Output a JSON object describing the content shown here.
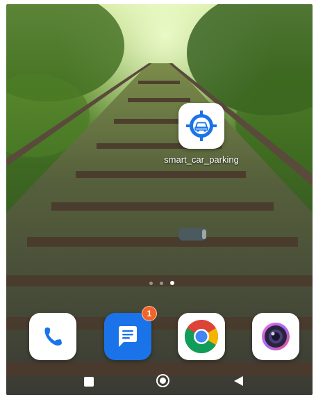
{
  "home_screen": {
    "apps": [
      {
        "label": "smart_car_parking",
        "icon": "car-location-target-icon"
      }
    ],
    "page_indicator": {
      "pages": 3,
      "current": 3
    }
  },
  "dock": [
    {
      "name": "Phone",
      "icon": "phone-icon"
    },
    {
      "name": "Messages",
      "icon": "messages-icon",
      "badge": "1"
    },
    {
      "name": "Chrome",
      "icon": "chrome-icon"
    },
    {
      "name": "Camera",
      "icon": "camera-icon"
    }
  ],
  "navigation": {
    "buttons": [
      "recents-icon",
      "home-icon",
      "back-icon"
    ]
  },
  "colors": {
    "accent_blue": "#1a73e8",
    "badge_orange": "#f0642a"
  }
}
